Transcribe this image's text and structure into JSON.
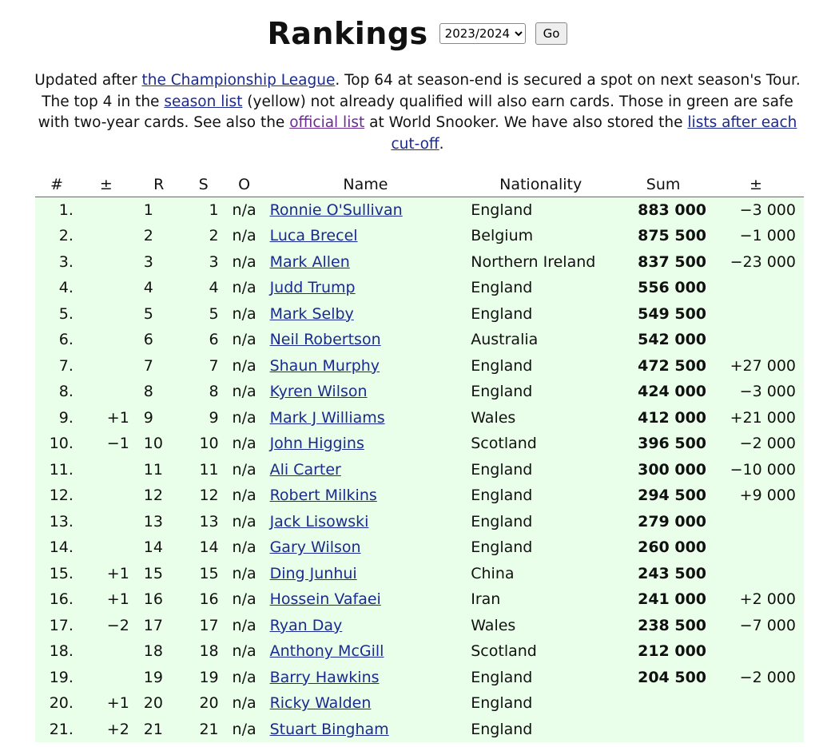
{
  "header": {
    "title": "Rankings",
    "season_selected": "2023/2024",
    "go_label": "Go"
  },
  "intro": {
    "t1": "Updated after ",
    "link_event": "the Championship League",
    "t2": ". Top 64 at season-end is secured a spot on next season's Tour. The top 4 in the ",
    "link_season": "season list",
    "t3": " (yellow) not already qualified will also earn cards. Those in green are safe with two-year cards. See also the ",
    "link_official": "official list",
    "t4": " at World Snooker. We have also stored the ",
    "link_cutoff": "lists after each cut-off",
    "t5": "."
  },
  "table": {
    "headers": [
      "#",
      "±",
      "R",
      "S",
      "O",
      "Name",
      "Nationality",
      "Sum",
      "±"
    ],
    "rows": [
      [
        "1.",
        "",
        "1",
        "1",
        "n/a",
        "Ronnie O'Sullivan",
        "England",
        "883 000",
        "−3 000"
      ],
      [
        "2.",
        "",
        "2",
        "2",
        "n/a",
        "Luca Brecel",
        "Belgium",
        "875 500",
        "−1 000"
      ],
      [
        "3.",
        "",
        "3",
        "3",
        "n/a",
        "Mark Allen",
        "Northern Ireland",
        "837 500",
        "−23 000"
      ],
      [
        "4.",
        "",
        "4",
        "4",
        "n/a",
        "Judd Trump",
        "England",
        "556 000",
        ""
      ],
      [
        "5.",
        "",
        "5",
        "5",
        "n/a",
        "Mark Selby",
        "England",
        "549 500",
        ""
      ],
      [
        "6.",
        "",
        "6",
        "6",
        "n/a",
        "Neil Robertson",
        "Australia",
        "542 000",
        ""
      ],
      [
        "7.",
        "",
        "7",
        "7",
        "n/a",
        "Shaun Murphy",
        "England",
        "472 500",
        "+27 000"
      ],
      [
        "8.",
        "",
        "8",
        "8",
        "n/a",
        "Kyren Wilson",
        "England",
        "424 000",
        "−3 000"
      ],
      [
        "9.",
        "+1",
        "9",
        "9",
        "n/a",
        "Mark J Williams",
        "Wales",
        "412 000",
        "+21 000"
      ],
      [
        "10.",
        "−1",
        "10",
        "10",
        "n/a",
        "John Higgins",
        "Scotland",
        "396 500",
        "−2 000"
      ],
      [
        "11.",
        "",
        "11",
        "11",
        "n/a",
        "Ali Carter",
        "England",
        "300 000",
        "−10 000"
      ],
      [
        "12.",
        "",
        "12",
        "12",
        "n/a",
        "Robert Milkins",
        "England",
        "294 500",
        "+9 000"
      ],
      [
        "13.",
        "",
        "13",
        "13",
        "n/a",
        "Jack Lisowski",
        "England",
        "279 000",
        ""
      ],
      [
        "14.",
        "",
        "14",
        "14",
        "n/a",
        "Gary Wilson",
        "England",
        "260 000",
        ""
      ],
      [
        "15.",
        "+1",
        "15",
        "15",
        "n/a",
        "Ding Junhui",
        "China",
        "243 500",
        ""
      ],
      [
        "16.",
        "+1",
        "16",
        "16",
        "n/a",
        "Hossein Vafaei",
        "Iran",
        "241 000",
        "+2 000"
      ],
      [
        "17.",
        "−2",
        "17",
        "17",
        "n/a",
        "Ryan Day",
        "Wales",
        "238 500",
        "−7 000"
      ],
      [
        "18.",
        "",
        "18",
        "18",
        "n/a",
        "Anthony McGill",
        "Scotland",
        "212 000",
        ""
      ],
      [
        "19.",
        "",
        "19",
        "19",
        "n/a",
        "Barry Hawkins",
        "England",
        "204 500",
        "−2 000"
      ],
      [
        "20.",
        "+1",
        "20",
        "20",
        "n/a",
        "Ricky Walden",
        "England",
        "",
        ""
      ],
      [
        "21.",
        "+2",
        "21",
        "21",
        "n/a",
        "Stuart Bingham",
        "England",
        "",
        ""
      ]
    ]
  },
  "colors": {
    "safe_row_green": "#eaffea",
    "link": "#1a2a8f",
    "visited_link": "#6a2a8f"
  }
}
